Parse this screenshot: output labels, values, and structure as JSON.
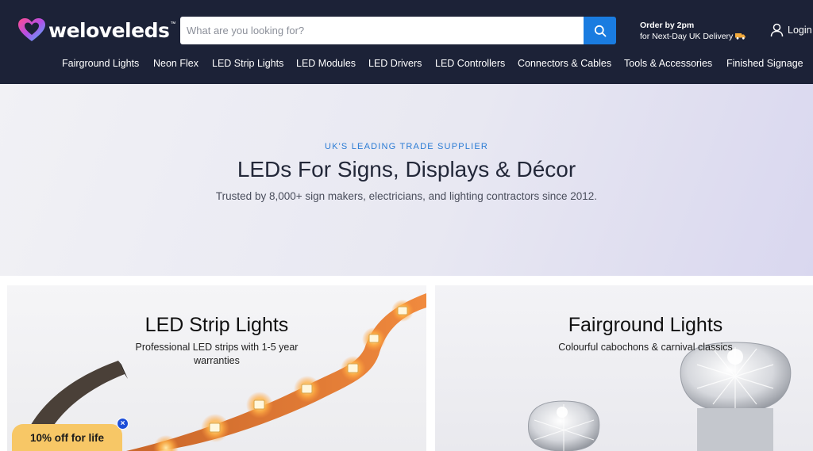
{
  "brand": {
    "name": "weloveleds",
    "tm": "™",
    "colors": {
      "header_bg": "#1c2237",
      "accent_blue": "#1a7ce0",
      "promo_yellow": "#f7c766"
    }
  },
  "search": {
    "placeholder": "What are you looking for?",
    "value": "",
    "icon": "search-icon"
  },
  "delivery": {
    "line1": "Order by 2pm",
    "line2": "for Next-Day UK Delivery"
  },
  "account": {
    "login_label": "Login",
    "icon": "user-icon"
  },
  "nav": {
    "items": [
      {
        "label": "Fairground Lights"
      },
      {
        "label": "Neon Flex"
      },
      {
        "label": "LED Strip Lights"
      },
      {
        "label": "LED Modules"
      },
      {
        "label": "LED Drivers"
      },
      {
        "label": "LED Controllers"
      },
      {
        "label": "Connectors & Cables"
      },
      {
        "label": "Tools & Accessories"
      },
      {
        "label": "Finished Signage"
      }
    ]
  },
  "hero": {
    "kicker": "UK'S LEADING TRADE SUPPLIER",
    "title": "LEDs For Signs, Displays & Décor",
    "subtitle": "Trusted by 8,000+ sign makers, electricians, and lighting contractors since 2012."
  },
  "cards": [
    {
      "title": "LED Strip Lights",
      "subtitle": "Professional LED strips with 1-5 year warranties"
    },
    {
      "title": "Fairground Lights",
      "subtitle": "Colourful cabochons & carnival classics"
    }
  ],
  "promo": {
    "label": "10% off for life",
    "close": "×"
  }
}
